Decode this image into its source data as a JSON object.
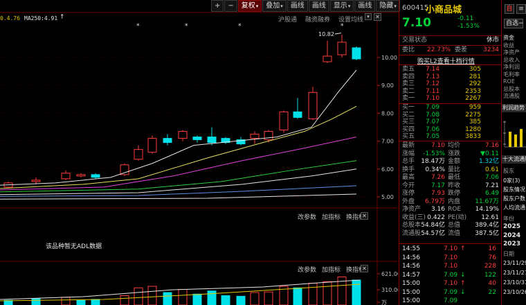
{
  "header": {
    "ma_left_value": "0.4.76",
    "ma250_label": "MA250:4.91"
  },
  "toolbar": {
    "buttons": [
      {
        "label": "+",
        "active": false
      },
      {
        "label": "−",
        "active": false
      },
      {
        "label": "复权",
        "active": true,
        "dropdown": true
      },
      {
        "label": "叠加",
        "active": false,
        "dropdown": true
      },
      {
        "label": "画线",
        "active": false
      },
      {
        "label": "画线",
        "active": false
      },
      {
        "label": "显示",
        "active": false,
        "dropdown": true
      },
      {
        "label": "画线",
        "active": false
      },
      {
        "label": "隐藏",
        "active": false,
        "dropdown": true
      }
    ]
  },
  "subtoolbar": {
    "links": [
      "沪股通",
      "融资融券",
      "设置均线"
    ]
  },
  "price_axis": {
    "ticks": [
      "10.00",
      "9.00",
      "8.00",
      "7.00",
      "6.00",
      "5.00"
    ],
    "high_label": "10.82"
  },
  "panel2": {
    "buttons": [
      "改参数",
      "加指标",
      "换指标"
    ],
    "message": "该品种暂无ADL数据"
  },
  "panel3": {
    "buttons": [
      "改参数",
      "加指标",
      "换指标"
    ],
    "axis_ticks": [
      "621.00",
      "310.00",
      "万"
    ]
  },
  "quote": {
    "code": "600415",
    "name": "小商品城",
    "price": "7.10",
    "change": "-0.11",
    "change_pct": "-1.53%",
    "status_label": "交易状态",
    "status_value": "休市",
    "ratio_label": "委比",
    "ratio_value": "22.73%",
    "diff_label": "委差",
    "diff_value": "3234",
    "level2_link": "购买L2查看十档行情",
    "self_select": "自选",
    "self_select_dd": "−"
  },
  "sells": [
    {
      "label": "卖五",
      "price": "7.14",
      "vol": "305"
    },
    {
      "label": "卖四",
      "price": "7.13",
      "vol": "281"
    },
    {
      "label": "卖三",
      "price": "7.12",
      "vol": "292"
    },
    {
      "label": "卖二",
      "price": "7.11",
      "vol": "2353"
    },
    {
      "label": "卖一",
      "price": "7.10",
      "vol": "2267"
    }
  ],
  "buys": [
    {
      "label": "买一",
      "price": "7.09",
      "vol": "959"
    },
    {
      "label": "买二",
      "price": "7.08",
      "vol": "2275"
    },
    {
      "label": "买三",
      "price": "7.07",
      "vol": "385"
    },
    {
      "label": "买四",
      "price": "7.06",
      "vol": "1280"
    },
    {
      "label": "买五",
      "price": "7.05",
      "vol": "3833"
    }
  ],
  "stats": [
    {
      "l1": "最新",
      "v1": "7.10",
      "c1": "red",
      "l2": "均价",
      "v2": "7.16",
      "c2": "red"
    },
    {
      "l1": "涨幅",
      "v1": "-1.53%",
      "c1": "green",
      "l2": "涨跌",
      "v2": "▼0.11",
      "c2": "green"
    },
    {
      "l1": "总手",
      "v1": "18.47万",
      "c1": "white",
      "l2": "金额",
      "v2": "1.32亿",
      "c2": "cyan"
    },
    {
      "l1": "换手",
      "v1": "0.34%",
      "c1": "white",
      "l2": "量比",
      "v2": "0.61",
      "c2": "yellow"
    },
    {
      "l1": "最高",
      "v1": "7.26",
      "c1": "red",
      "l2": "最低",
      "v2": "7.06",
      "c2": "green"
    },
    {
      "l1": "今开",
      "v1": "7.17",
      "c1": "green",
      "l2": "昨收",
      "v2": "7.21",
      "c2": "white"
    },
    {
      "l1": "涨停",
      "v1": "7.93",
      "c1": "red",
      "l2": "跌停",
      "v2": "6.49",
      "c2": "green"
    },
    {
      "l1": "外盘",
      "v1": "6.79万",
      "c1": "red",
      "l2": "内盘",
      "v2": "11.67万",
      "c2": "green"
    },
    {
      "l1": "净资产",
      "v1": "3.16",
      "c1": "white",
      "l2": "ROE",
      "v2": "14.19%",
      "c2": "white"
    },
    {
      "l1": "收益(三)",
      "v1": "0.422",
      "c1": "white",
      "l2": "PE(动)",
      "v2": "12.61",
      "c2": "white"
    },
    {
      "l1": "总股本",
      "v1": "54.84亿",
      "c1": "white",
      "l2": "总值",
      "v2": "389.4亿",
      "c2": "white"
    },
    {
      "l1": "流通股",
      "v1": "54.57亿",
      "c1": "white",
      "l2": "流值",
      "v2": "387.5亿",
      "c2": "white"
    }
  ],
  "ticks": [
    {
      "time": "14:55",
      "price": "7.10",
      "arrow": "↑",
      "vol": "16",
      "pc": "red",
      "vc": "red"
    },
    {
      "time": "14:56",
      "price": "7.10",
      "arrow": "",
      "vol": "76",
      "pc": "red",
      "vc": "red"
    },
    {
      "time": "14:56",
      "price": "7.10",
      "arrow": "",
      "vol": "228",
      "pc": "red",
      "vc": "red"
    },
    {
      "time": "14:57",
      "price": "7.09",
      "arrow": "↓",
      "vol": "122",
      "pc": "green",
      "vc": "green"
    },
    {
      "time": "15:00",
      "price": "7.10",
      "arrow": "↑",
      "vol": "40",
      "pc": "red",
      "vc": "red"
    },
    {
      "time": "15:00",
      "price": "7.09",
      "arrow": "↓",
      "vol": "22",
      "pc": "green",
      "vc": "green"
    },
    {
      "time": "15:00",
      "price": "7.09",
      "arrow": "",
      "vol": "",
      "pc": "green",
      "vc": "green"
    }
  ],
  "far_right": {
    "tabs": [
      "资金",
      "收益",
      "净资产",
      "总收入",
      "净利润",
      "毛利率",
      "ROE",
      "总股本",
      "流通股"
    ],
    "profit_label": "利润趋势",
    "top10_label": "十大流通股",
    "shareholder_label": "股东",
    "item1": "0家(3)",
    "item2": "股东情况",
    "item3": "股东户数",
    "item4": "人均流通",
    "year_label": "年份",
    "years": [
      "2025",
      "2024",
      "2023"
    ],
    "date_label": "日期",
    "dates": [
      "23/11/29",
      "23/11/27",
      "23/10/31",
      "23/10/26"
    ]
  }
}
